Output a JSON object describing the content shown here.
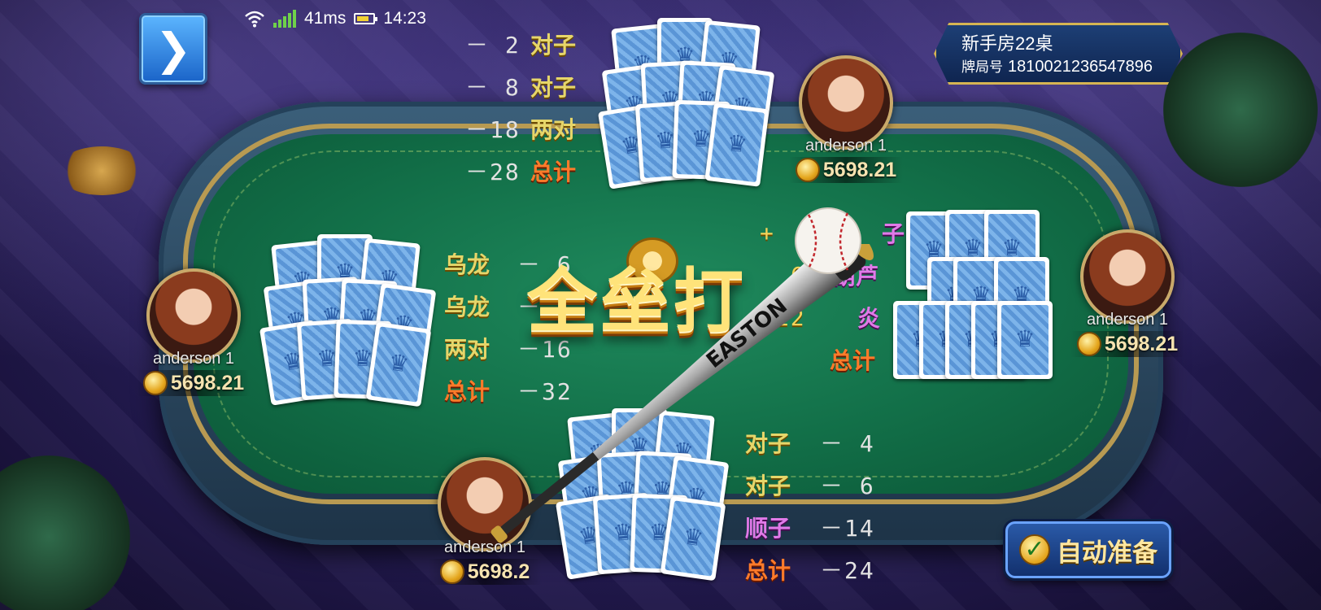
{
  "status_bar": {
    "ping": "41ms",
    "time": "14:23",
    "wifi_icon": "wifi-icon",
    "signal_icon": "signal-icon",
    "battery_icon": "battery-icon"
  },
  "back_button": {
    "icon": "chevron-right-icon",
    "glyph": "❯"
  },
  "room": {
    "name": "新手房22桌",
    "id_label": "牌局号",
    "id_value": "1810021236547896"
  },
  "players": {
    "top": {
      "name": "anderson 1",
      "coins": "5698.21"
    },
    "left": {
      "name": "anderson 1",
      "coins": "5698.21"
    },
    "right": {
      "name": "anderson 1",
      "coins": "5698.21"
    },
    "bottom": {
      "name": "anderson 1",
      "coins": "5698.2"
    }
  },
  "scores": {
    "top": [
      {
        "value": "－ 2",
        "hand": "对子"
      },
      {
        "value": "－ 8",
        "hand": "对子"
      },
      {
        "value": "－18",
        "hand": "两对"
      },
      {
        "value": "－28",
        "hand": "总计"
      }
    ],
    "left": [
      {
        "hand": "乌龙",
        "value": "－ 6"
      },
      {
        "hand": "乌龙",
        "value": "－"
      },
      {
        "hand": "两对",
        "value": "－16"
      },
      {
        "hand": "总计",
        "value": "－32"
      }
    ],
    "right": [
      {
        "value": "+",
        "hand": "子"
      },
      {
        "value": "6",
        "hand": "葫芦"
      },
      {
        "value": "+12",
        "hand": "炎"
      },
      {
        "value": "",
        "hand": "总计"
      }
    ],
    "bottom": [
      {
        "hand": "对子",
        "value": "－ 4"
      },
      {
        "hand": "对子",
        "value": "－ 6"
      },
      {
        "hand": "顺子",
        "value": "－14"
      },
      {
        "hand": "总计",
        "value": "－24"
      }
    ]
  },
  "effect": {
    "text": "全垒打",
    "bat_brand": "EASTON"
  },
  "auto_ready": {
    "label": "自动准备",
    "icon": "checkmark-icon"
  },
  "colors": {
    "felt": "#137a4e",
    "rail": "#2a4a63",
    "gold": "#d6b552",
    "total": "#ff7b2a"
  }
}
